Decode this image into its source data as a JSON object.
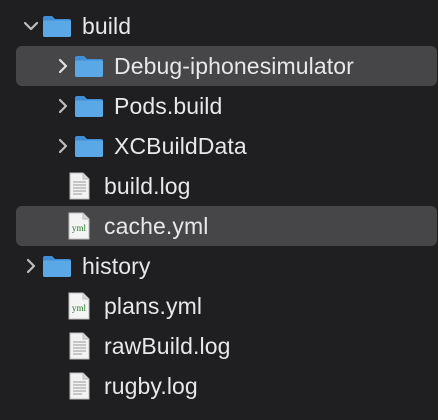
{
  "tree": {
    "items": [
      {
        "label": "build",
        "icon": "folder-icon",
        "expanded": true,
        "level": 0
      },
      {
        "label": "Debug-iphonesimulator",
        "icon": "folder-icon",
        "expanded": false,
        "level": 1,
        "selected": true
      },
      {
        "label": "Pods.build",
        "icon": "folder-icon",
        "expanded": false,
        "level": 1
      },
      {
        "label": "XCBuildData",
        "icon": "folder-icon",
        "expanded": false,
        "level": 1
      },
      {
        "label": "build.log",
        "icon": "text-file-icon",
        "level": 1
      },
      {
        "label": "cache.yml",
        "icon": "yml-file-icon",
        "level": 1,
        "selected": true
      },
      {
        "label": "history",
        "icon": "folder-icon",
        "expanded": false,
        "level": 0
      },
      {
        "label": "plans.yml",
        "icon": "yml-file-icon",
        "level": 1
      },
      {
        "label": "rawBuild.log",
        "icon": "text-file-icon",
        "level": 1
      },
      {
        "label": "rugby.log",
        "icon": "text-file-icon",
        "level": 1
      }
    ],
    "yml_badge": "yml"
  },
  "colors": {
    "background": "#1f1f21",
    "selection": "#464649",
    "folder_blue": "#5aa8e6",
    "text": "#e8e8e8"
  }
}
